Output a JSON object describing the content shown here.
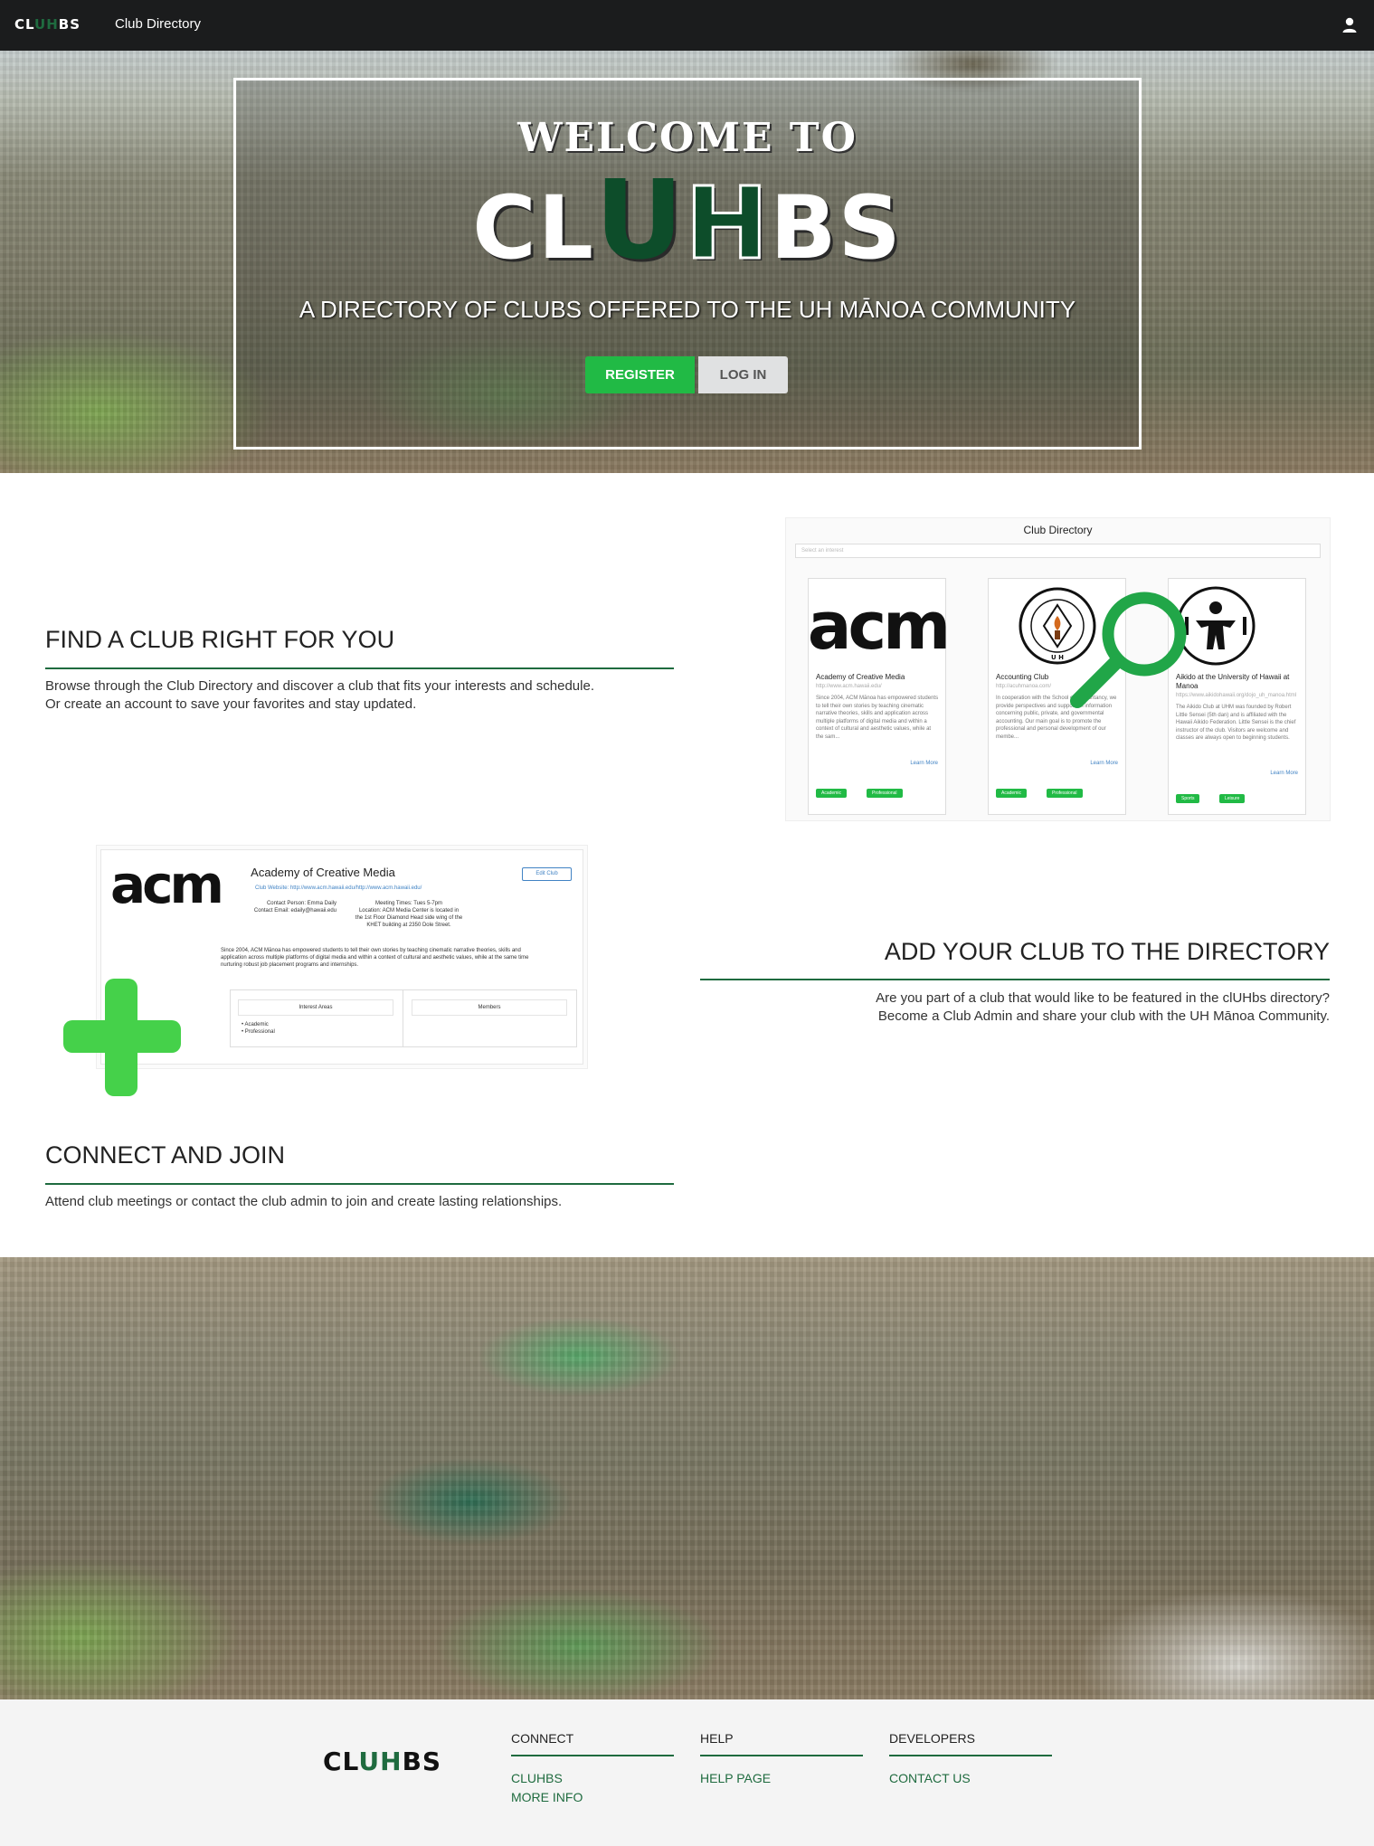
{
  "nav": {
    "logo_parts": [
      "CL",
      "U",
      "H",
      "BS"
    ],
    "directory_link": "Club Directory",
    "user_icon": "user-icon"
  },
  "hero": {
    "welcome": "WELCOME TO",
    "title_parts": [
      "CL",
      "U",
      "H",
      "BS"
    ],
    "subtitle": "A DIRECTORY OF CLUBS OFFERED TO THE UH MĀNOA COMMUNITY",
    "register_label": "REGISTER",
    "login_label": "LOG IN"
  },
  "find": {
    "title": "FIND A CLUB RIGHT FOR YOU",
    "line1": "Browse through the Club Directory and discover a club that fits your interests and schedule.",
    "line2": "Or create an account to save your favorites and stay updated."
  },
  "directory_preview": {
    "title": "Club Directory",
    "select_placeholder": "Select an interest",
    "cards": [
      {
        "logo": "acm",
        "name": "Academy of Creative Media",
        "url": "http://www.acm.hawaii.edu/",
        "desc": "Since 2004, ACM Mānoa has empowered students to tell their own stories by teaching cinematic narrative theories, skills and application across multiple platforms of digital media and within a context of cultural and aesthetic values, while at the sam...",
        "more": "Learn More",
        "tags": [
          "Academic",
          "Professional"
        ]
      },
      {
        "logo": "ACCOUNTING CLUB",
        "name": "Accounting Club",
        "url": "http://acuhmanoa.com/",
        "desc": "In cooperation with the School of Accountancy, we provide perspectives and support on information concerning public, private, and governmental accounting. Our main goal is to promote the professional and personal development of our membe...",
        "more": "Learn More",
        "tags": [
          "Academic",
          "Professional"
        ]
      },
      {
        "logo": "aikido",
        "name": "Aikido at the University of Hawaii at Manoa",
        "url": "https://www.aikidohawaii.org/dojo_uh_manoa.html",
        "desc": "The Aikido Club at UHM was founded by Robert Little Sensei (5th dan) and is affiliated with the Hawaii Aikido Federation. Little Sensei is the chief instructor of the club. Visitors are welcome and classes are always open to beginning students.",
        "more": "Learn More",
        "tags": [
          "Sports",
          "Leisure"
        ]
      }
    ]
  },
  "add": {
    "title": "ADD YOUR CLUB TO THE DIRECTORY",
    "line1": "Are you part of a club that would like to be featured in the clUHbs directory?",
    "line2": "Become a Club Admin and share your club with the UH Mānoa Community."
  },
  "acm_preview": {
    "logo": "acm",
    "title": "Academy of Creative Media",
    "edit_label": "Edit Club",
    "website": "Club Website: http://www.acm.hawaii.edu/http://www.acm.hawaii.edu/",
    "contact_person": "Contact Person: Emma Daily",
    "contact_email": "Contact Email: edaily@hawaii.edu",
    "meeting": "Meeting Times: Tues 5-7pm",
    "location1": "Location: ACM Media Center is located in",
    "location2": "the 1st Floor Diamond Head side wing of the",
    "location3": "KHET building at 2350 Dole Street.",
    "desc1": "Since 2004, ACM Mānoa has empowered students to tell their own stories by teaching cinematic narrative theories, skills and",
    "desc2": "application across multiple platforms of digital media and within a context of cultural and aesthetic values, while at the same time",
    "desc3": "nurturing robust job placement programs and internships.",
    "interest_header": "Interest Areas",
    "members_header": "Members",
    "interests": [
      "Academic",
      "Professional"
    ]
  },
  "connect": {
    "title": "CONNECT AND JOIN",
    "line1": "Attend club meetings or contact the club admin to join and create lasting relationships."
  },
  "footer": {
    "logo_parts": [
      "CL",
      "U",
      "H",
      "BS"
    ],
    "connect_head": "CONNECT",
    "connect_links": [
      "CLUHBS",
      "MORE INFO"
    ],
    "help_head": "HELP",
    "help_links": [
      "HELP PAGE"
    ],
    "dev_head": "DEVELOPERS",
    "dev_links": [
      "CONTACT US"
    ]
  },
  "colors": {
    "brand_green": "#1f6b3f",
    "button_green": "#21ba45",
    "nav_bg": "#1b1c1d"
  }
}
